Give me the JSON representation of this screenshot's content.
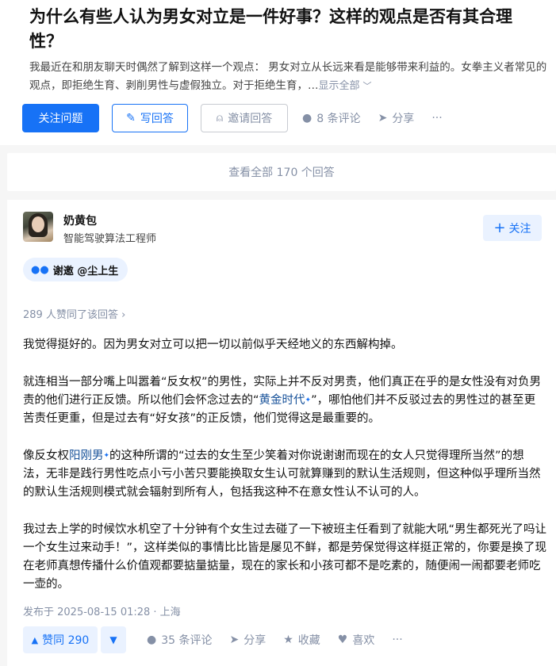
{
  "question": {
    "title": "为什么有些人认为男女对立是一件好事？这样的观点是否有其合理性？",
    "excerpt": "我最近在和朋友聊天时偶然了解到这样一个观点： 男女对立从长远来看是能够带来利益的。女拳主义者常见的观点，即拒绝生育、剥削男性与虚假独立。对于拒绝生育，…",
    "show_all": "显示全部",
    "follow_label": "关注问题",
    "write_label": "写回答",
    "invite_label": "邀请回答",
    "comments": "8 条评论",
    "share": "分享",
    "more": "···"
  },
  "all_answers_label": "查看全部 170 个回答",
  "answer": {
    "author": "奶黄包",
    "bio": "智能驾驶算法工程师",
    "follow_label": "关注",
    "invite_tag": "谢邀 @尘上生",
    "upvote_line": "289 人赞同了该回答 ›",
    "paragraphs": {
      "p1": "我觉得挺好的。因为男女对立可以把一切以前似乎天经地义的东西解构掉。",
      "p2a": "就连相当一部分嘴上叫嚣着“反女权”的男性，实际上并不反对男责，他们真正在乎的是女性没有对负男责的他们进行正反馈。所以他们会怀念过去的“",
      "p2link": "黄金时代",
      "p2b": "”，哪怕他们并不反驳过去的男性过的甚至更苦责任更重，但是过去有“好女孩”的正反馈，他们觉得这是最重要的。",
      "p3a": "像反女权",
      "p3link": "阳刚男",
      "p3b": "的这种所谓的“过去的女生至少笑着对你说谢谢而现在的女人只觉得理所当然”的想法，无非是践行男性吃点小亏小苦只要能换取女生认可就算赚到的默认生活规则，但这种似乎理所当然的默认生活规则模式就会辐射到所有人，包括我这种不在意女性认不认可的人。",
      "p4": "我过去上学的时候饮水机空了十分钟有个女生过去碰了一下被班主任看到了就能大吼“男生都死光了吗让一个女生过来动手！”，这样类似的事情比比皆是屡见不鲜，都是劳保觉得这样挺正常的，你要是换了现在老师真想传播什么价值观都要掂量掂量，现在的家长和小孩可都不是吃素的，随便闹一闹都要老师吃一壶的。"
    },
    "published": "发布于 2025-08-15 01:28 · 上海",
    "vote_label": "赞同 290",
    "comments": "35 条评论",
    "share": "分享",
    "collect": "收藏",
    "like": "喜欢",
    "more": "···"
  },
  "colors": {
    "primary": "#1772f6",
    "meta_gray": "#8590a6",
    "link": "#175199"
  }
}
